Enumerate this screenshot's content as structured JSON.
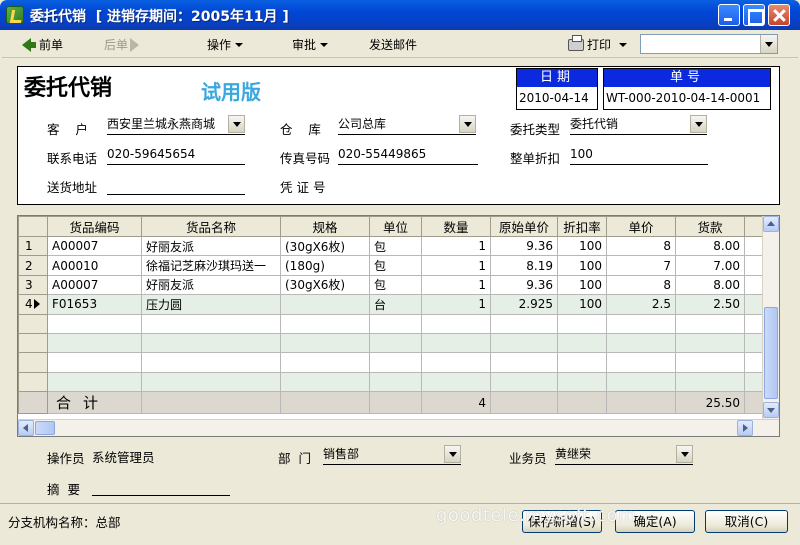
{
  "window": {
    "title": "委托代销  [ 进销存期间：2005年11月 ]"
  },
  "toolbar": {
    "prev": "前单",
    "next": "后单",
    "operate": "操作",
    "approve": "审批",
    "send_mail": "发送邮件",
    "print": "打印",
    "combo_value": ""
  },
  "form": {
    "title": "委托代销",
    "trial": "试用版",
    "date_label": "日期",
    "date_value": "2010-04-14",
    "no_label": "单号",
    "no_value": "WT-000-2010-04-14-0001",
    "customer_label": "客    户",
    "customer_value": "西安里兰城永燕商城",
    "warehouse_label": "仓    库",
    "warehouse_value": "公司总库",
    "type_label": "委托类型",
    "type_value": "委托代销",
    "phone_label": "联系电话",
    "phone_value": "020-59645654",
    "fax_label": "传真号码",
    "fax_value": "020-55449865",
    "discount_label": "整单折扣",
    "discount_value": "100",
    "address_label": "送货地址",
    "address_value": "",
    "voucher_label": "凭 证 号",
    "voucher_value": ""
  },
  "grid": {
    "columns": [
      "货品编码",
      "货品名称",
      "规格",
      "单位",
      "数量",
      "原始单价",
      "折扣率",
      "单价",
      "货款"
    ],
    "rows": [
      {
        "no": "1",
        "code": "A00007",
        "name": "好丽友派",
        "spec": "(30gX6枚)",
        "unit": "包",
        "qty": "1",
        "orig_price": "9.36",
        "rate": "100",
        "price": "8",
        "amount": "8.00"
      },
      {
        "no": "2",
        "code": "A00010",
        "name": "徐福记芝麻沙琪玛送一",
        "spec": "(180g)",
        "unit": "包",
        "qty": "1",
        "orig_price": "8.19",
        "rate": "100",
        "price": "7",
        "amount": "7.00"
      },
      {
        "no": "3",
        "code": "A00007",
        "name": "好丽友派",
        "spec": "(30gX6枚)",
        "unit": "包",
        "qty": "1",
        "orig_price": "9.36",
        "rate": "100",
        "price": "8",
        "amount": "8.00"
      },
      {
        "no": "4",
        "code": "F01653",
        "name": "压力圆",
        "spec": "",
        "unit": "台",
        "qty": "1",
        "orig_price": "2.925",
        "rate": "100",
        "price": "2.5",
        "amount": "2.50"
      }
    ],
    "total_label": "合计",
    "total_qty": "4",
    "total_amount": "25.50"
  },
  "footer": {
    "operator_label": "操作员",
    "operator_value": "系统管理员",
    "dept_label": "部  门",
    "dept_value": "销售部",
    "salesman_label": "业务员",
    "salesman_value": "黄继荣",
    "summary_label": "摘  要",
    "summary_value": "",
    "branch_text": "分支机构名称：总部",
    "save_new": "保存新增(S)",
    "ok": "确定(A)",
    "cancel": "取消(C)",
    "watermark": "goodtele.mysoft.com"
  }
}
